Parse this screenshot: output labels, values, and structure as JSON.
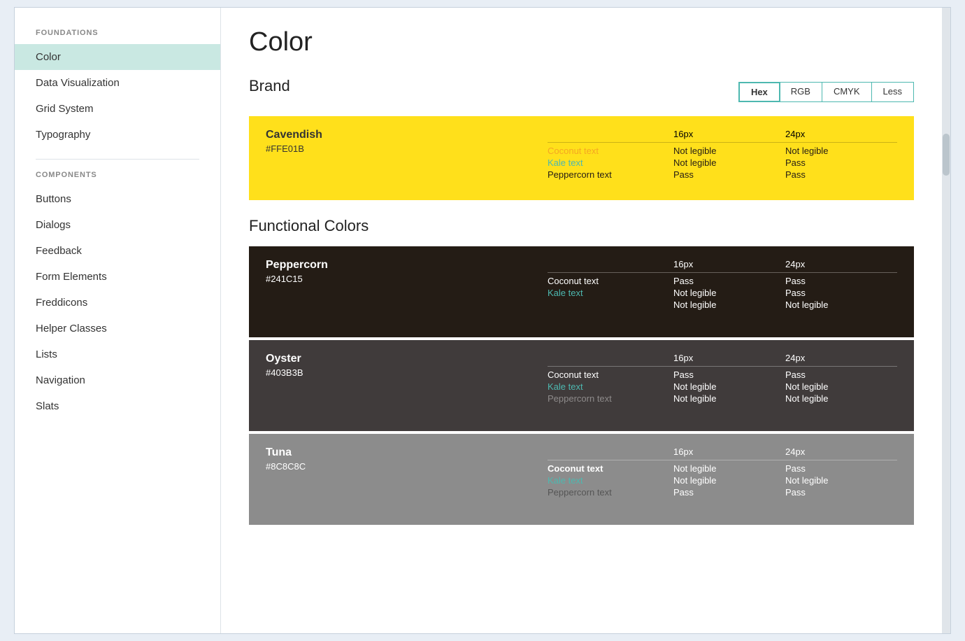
{
  "page": {
    "title": "Color"
  },
  "sidebar": {
    "foundations_label": "FOUNDATIONS",
    "components_label": "COMPONENTS",
    "foundations_items": [
      {
        "label": "Color",
        "active": true
      },
      {
        "label": "Data Visualization",
        "active": false
      },
      {
        "label": "Grid System",
        "active": false
      },
      {
        "label": "Typography",
        "active": false
      }
    ],
    "components_items": [
      {
        "label": "Buttons",
        "active": false
      },
      {
        "label": "Dialogs",
        "active": false
      },
      {
        "label": "Feedback",
        "active": false
      },
      {
        "label": "Form Elements",
        "active": false
      },
      {
        "label": "Freddicons",
        "active": false
      },
      {
        "label": "Helper Classes",
        "active": false
      },
      {
        "label": "Lists",
        "active": false
      },
      {
        "label": "Navigation",
        "active": false
      },
      {
        "label": "Slats",
        "active": false
      }
    ]
  },
  "brand_section": {
    "title": "Brand",
    "format_tabs": [
      "Hex",
      "RGB",
      "CMYK",
      "Less"
    ],
    "active_tab": "Hex"
  },
  "cavendish": {
    "name": "Cavendish",
    "hex": "#FFE01B",
    "col_16px": "16px",
    "col_24px": "24px",
    "rows": [
      {
        "label": "Coconut text",
        "color": "coconut",
        "px16": "Not legible",
        "px24": "Not legible"
      },
      {
        "label": "Kale text",
        "color": "kale",
        "px16": "Not legible",
        "px24": "Pass"
      },
      {
        "label": "Peppercorn text",
        "color": "peppercorn",
        "px16": "Pass",
        "px24": "Pass"
      }
    ]
  },
  "functional_section": {
    "title": "Functional Colors"
  },
  "peppercorn": {
    "name": "Peppercorn",
    "hex": "#241C15",
    "col_16px": "16px",
    "col_24px": "24px",
    "rows": [
      {
        "label": "Coconut text",
        "color": "white",
        "px16": "Pass",
        "px24": "Pass"
      },
      {
        "label": "Kale text",
        "color": "kale",
        "px16": "Not legible",
        "px24": "Pass"
      },
      {
        "label": "",
        "color": "white",
        "px16": "Not legible",
        "px24": "Not legible"
      }
    ]
  },
  "oyster": {
    "name": "Oyster",
    "hex": "#403B3B",
    "col_16px": "16px",
    "col_24px": "24px",
    "rows": [
      {
        "label": "Coconut text",
        "color": "white",
        "px16": "Pass",
        "px24": "Pass"
      },
      {
        "label": "Kale text",
        "color": "kale",
        "px16": "Not legible",
        "px24": "Not legible"
      },
      {
        "label": "Peppercorn text",
        "color": "dim",
        "px16": "Not legible",
        "px24": "Not legible"
      }
    ]
  },
  "tuna": {
    "name": "Tuna",
    "hex": "#8C8C8C",
    "col_16px": "16px",
    "col_24px": "24px",
    "rows": [
      {
        "label": "Coconut text",
        "color": "white",
        "px16": "Not legible",
        "px24": "Pass"
      },
      {
        "label": "Kale text",
        "color": "kale",
        "px16": "Not legible",
        "px24": "Not legible"
      },
      {
        "label": "Peppercorn text",
        "color": "peppercorn-light",
        "px16": "Pass",
        "px24": "Pass"
      }
    ]
  }
}
